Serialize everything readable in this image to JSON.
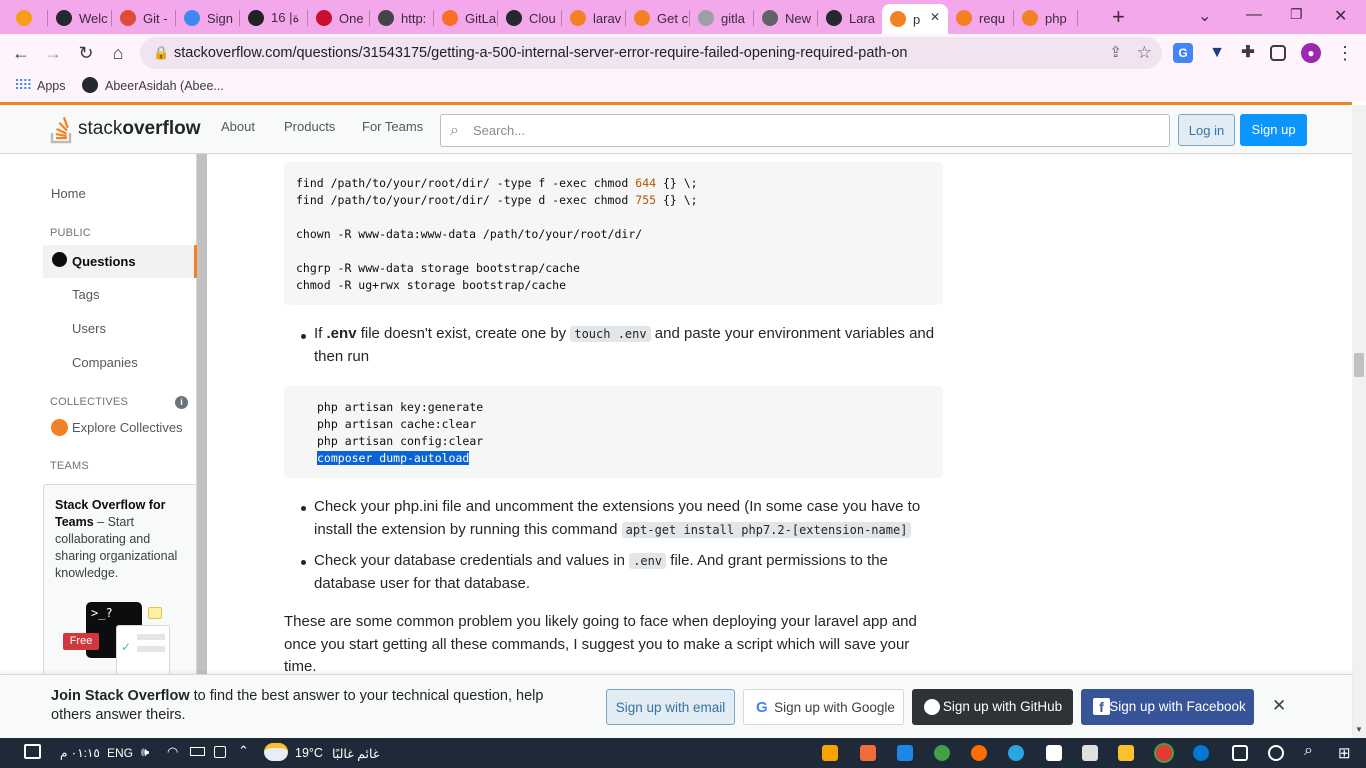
{
  "browser": {
    "tabs": [
      {
        "label": "",
        "icon": "pma-icon",
        "color": "#f89c1c"
      },
      {
        "label": "Welc",
        "icon": "github-icon",
        "color": "#24292f"
      },
      {
        "label": "Git -",
        "icon": "git-icon",
        "color": "#de4c36"
      },
      {
        "label": "Sign",
        "icon": "google-icon",
        "color": "#4285f4"
      },
      {
        "label": "ة| 16",
        "icon": "graduation-cap-icon",
        "color": "#222222"
      },
      {
        "label": "One",
        "icon": "onenote-icon",
        "color": "#c8102e"
      },
      {
        "label": "http:",
        "icon": "desktop-icon",
        "color": "#444444"
      },
      {
        "label": "GitLa",
        "icon": "gitlab-icon",
        "color": "#fc6d26"
      },
      {
        "label": "Clou",
        "icon": "github-icon",
        "color": "#24292f"
      },
      {
        "label": "larav",
        "icon": "stackoverflow-icon",
        "color": "#f48024"
      },
      {
        "label": "Get c",
        "icon": "stackoverflow-icon",
        "color": "#f48024"
      },
      {
        "label": "gitla",
        "icon": "globe-icon",
        "color": "#9aa0a6"
      },
      {
        "label": "New",
        "icon": "chrome-icon",
        "color": "#5f6368"
      },
      {
        "label": "Lara",
        "icon": "github-icon",
        "color": "#24292f"
      },
      {
        "label": "p",
        "icon": "stackoverflow-icon",
        "color": "#f48024",
        "active": true
      },
      {
        "label": "requ",
        "icon": "stackoverflow-icon",
        "color": "#f48024"
      },
      {
        "label": "php",
        "icon": "stackoverflow-icon",
        "color": "#f48024"
      }
    ],
    "new_tab": "+",
    "url": "stackoverflow.com/questions/31543175/getting-a-500-internal-server-error-require-failed-opening-required-path-on",
    "bookmarks": {
      "apps": "Apps",
      "item1": "AbeerAsidah (Abee..."
    }
  },
  "header": {
    "logo_stack": "stack",
    "logo_overflow": "overflow",
    "nav": [
      "About",
      "Products",
      "For Teams"
    ],
    "search_placeholder": "Search...",
    "login": "Log in",
    "signup": "Sign up"
  },
  "sidebar": {
    "home": "Home",
    "public": "PUBLIC",
    "questions": "Questions",
    "tags": "Tags",
    "users": "Users",
    "companies": "Companies",
    "collectives": "COLLECTIVES",
    "explore": "Explore Collectives",
    "teams": "TEAMS",
    "teams_title": "Stack Overflow for Teams",
    "teams_desc": " – Start collaborating and sharing organizational knowledge.",
    "free_badge": "Free",
    "terminal": ">_?"
  },
  "content": {
    "code1_line1_a": "find /path/to/your/root/dir/ -type f -exec chmod ",
    "code1_line1_num": "644",
    "code1_line1_b": " {} \\;",
    "code1_line2_a": "find /path/to/your/root/dir/ -type d -exec chmod ",
    "code1_line2_num": "755",
    "code1_line2_b": " {} \\;",
    "code1_line3": "chown -R www-data:www-data /path/to/your/root/dir/",
    "code1_line4": "chgrp -R www-data storage bootstrap/cache",
    "code1_line5": "chmod -R ug+rwx storage bootstrap/cache",
    "bullet1_a": "If ",
    "bullet1_b": ".env",
    "bullet1_c": " file doesn't exist, create one by ",
    "bullet1_code": "touch .env",
    "bullet1_d": " and paste your environment variables and",
    "bullet1_e": "then run",
    "code2_line1": "php artisan key:generate",
    "code2_line2": "php artisan cache:clear",
    "code2_line3": "php artisan config:clear",
    "code2_line4": "composer dump-autoload",
    "bullet2_a": "Check your php.ini file and uncomment the extensions you need (In some case you have to",
    "bullet2_b": "install the extension by running this command ",
    "bullet2_code": "apt-get install php7.2-[extension-name]",
    "bullet3_a": "Check your database credentials and values in ",
    "bullet3_code": ".env",
    "bullet3_b": " file. And grant permissions to the",
    "bullet3_c": "database user for that database.",
    "para1": "These are some common problem you likely going to face when deploying your laravel app and",
    "para2": "once you start getting all these commands, I suggest you to make a script which will save your",
    "para3": "time."
  },
  "banner": {
    "bold": "Join Stack Overflow",
    "text1": " to find the best answer to your technical question, help",
    "text2": "others answer theirs.",
    "email": "Sign up with email",
    "google": "Sign up with Google",
    "github": "Sign up with GitHub",
    "facebook": "Sign up with Facebook",
    "close": "✕"
  },
  "taskbar": {
    "time": "٠١:١٥ م",
    "lang": "ENG",
    "temp": "19°C",
    "weather": "غائم غالبًا"
  }
}
